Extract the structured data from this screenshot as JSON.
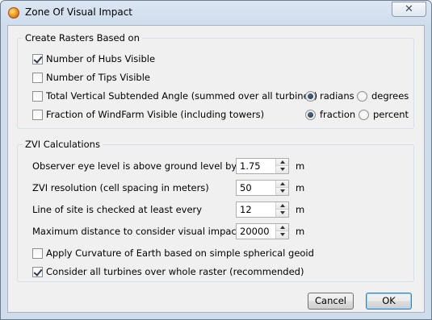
{
  "window": {
    "title": "Zone Of Visual Impact",
    "close_glyph": "✕"
  },
  "create_rasters": {
    "legend": "Create Rasters Based on",
    "hubs": {
      "label": "Number of Hubs Visible",
      "checked": true
    },
    "tips": {
      "label": "Number of Tips Visible",
      "checked": false
    },
    "angle": {
      "label": "Total Vertical Subtended Angle (summed over all turbines)",
      "checked": false,
      "options": [
        {
          "label": "radians",
          "selected": true
        },
        {
          "label": "degrees",
          "selected": false
        }
      ]
    },
    "fraction": {
      "label": "Fraction of WindFarm Visible (including towers)",
      "checked": false,
      "options": [
        {
          "label": "fraction",
          "selected": true
        },
        {
          "label": "percent",
          "selected": false
        }
      ]
    }
  },
  "zvi": {
    "legend": "ZVI Calculations",
    "eye_level": {
      "label": "Observer eye level is above ground level by",
      "value": "1.75",
      "unit": "m"
    },
    "resolution": {
      "label": "ZVI resolution (cell spacing in meters)",
      "value": "50",
      "unit": "m"
    },
    "line_of_site": {
      "label": "Line of site is checked at least every",
      "value": "12",
      "unit": "m"
    },
    "max_distance": {
      "label": "Maximum distance to consider visual impact",
      "value": "20000",
      "unit": "m"
    },
    "curvature": {
      "label": "Apply Curvature of Earth based on simple spherical geoid",
      "checked": false
    },
    "all_turbines": {
      "label": "Consider all turbines over whole raster (recommended)",
      "checked": true
    }
  },
  "buttons": {
    "cancel": "Cancel",
    "ok": "OK"
  }
}
